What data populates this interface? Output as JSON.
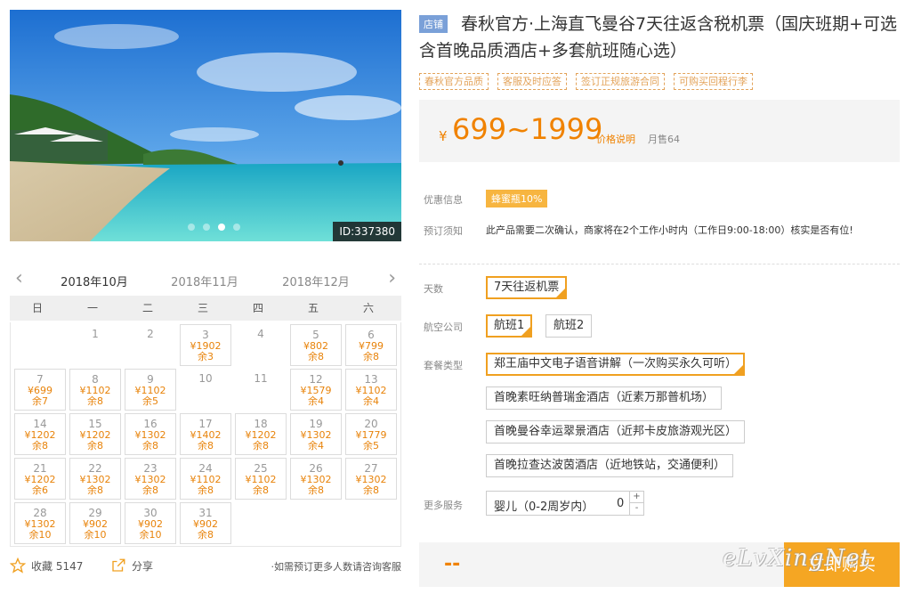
{
  "hero": {
    "id_label": "ID:337380",
    "slides": 4,
    "active_slide": 3
  },
  "calendar": {
    "months": [
      "2018年10月",
      "2018年11月",
      "2018年12月"
    ],
    "active_month": 0,
    "weekdays": [
      "日",
      "一",
      "二",
      "三",
      "四",
      "五",
      "六"
    ],
    "days": [
      {
        "d": "1",
        "price": "",
        "remain": ""
      },
      {
        "d": "2",
        "price": "",
        "remain": ""
      },
      {
        "d": "3",
        "price": "¥1902",
        "remain": "余3"
      },
      {
        "d": "4",
        "price": "",
        "remain": ""
      },
      {
        "d": "5",
        "price": "¥802",
        "remain": "余8"
      },
      {
        "d": "6",
        "price": "¥799",
        "remain": "余8"
      },
      {
        "d": "7",
        "price": "¥699",
        "remain": "余7"
      },
      {
        "d": "8",
        "price": "¥1102",
        "remain": "余8"
      },
      {
        "d": "9",
        "price": "¥1102",
        "remain": "余5"
      },
      {
        "d": "10",
        "price": "",
        "remain": ""
      },
      {
        "d": "11",
        "price": "",
        "remain": ""
      },
      {
        "d": "12",
        "price": "¥1579",
        "remain": "余4"
      },
      {
        "d": "13",
        "price": "¥1102",
        "remain": "余4"
      },
      {
        "d": "14",
        "price": "¥1202",
        "remain": "余8"
      },
      {
        "d": "15",
        "price": "¥1202",
        "remain": "余8"
      },
      {
        "d": "16",
        "price": "¥1302",
        "remain": "余8"
      },
      {
        "d": "17",
        "price": "¥1402",
        "remain": "余8"
      },
      {
        "d": "18",
        "price": "¥1202",
        "remain": "余8"
      },
      {
        "d": "19",
        "price": "¥1302",
        "remain": "余4"
      },
      {
        "d": "20",
        "price": "¥1779",
        "remain": "余5"
      },
      {
        "d": "21",
        "price": "¥1202",
        "remain": "余6"
      },
      {
        "d": "22",
        "price": "¥1302",
        "remain": "余8"
      },
      {
        "d": "23",
        "price": "¥1302",
        "remain": "余8"
      },
      {
        "d": "24",
        "price": "¥1102",
        "remain": "余8"
      },
      {
        "d": "25",
        "price": "¥1102",
        "remain": "余8"
      },
      {
        "d": "26",
        "price": "¥1302",
        "remain": "余8"
      },
      {
        "d": "27",
        "price": "¥1302",
        "remain": "余8"
      },
      {
        "d": "28",
        "price": "¥1302",
        "remain": "余10"
      },
      {
        "d": "29",
        "price": "¥902",
        "remain": "余10"
      },
      {
        "d": "30",
        "price": "¥902",
        "remain": "余10"
      },
      {
        "d": "31",
        "price": "¥902",
        "remain": "余8"
      }
    ]
  },
  "actions": {
    "favorite_label": "收藏 5147",
    "share_label": "分享",
    "consult_note": "·如需预订更多人数请咨询客服"
  },
  "product": {
    "shop_tag": "店铺",
    "title": "春秋官方·上海直飞曼谷7天往返含税机票（国庆班期+可选含首晚品质酒店+多套航班随心选）",
    "features": [
      "春秋官方品质",
      "客服及时应答",
      "签订正规旅游合同",
      "可购买回程行李"
    ]
  },
  "price": {
    "currency": "¥",
    "range": "699~1999",
    "note": "价格说明",
    "sold": "月售64"
  },
  "info": {
    "promo_label": "优惠信息",
    "promo_badge": "蜂蜜瓶10%",
    "notice_label": "预订须知",
    "notice_text": "此产品需要二次确认，商家将在2个工作小时内（工作日9:00-18:00）核实是否有位!"
  },
  "options": {
    "days_label": "天数",
    "days": [
      "7天往返机票"
    ],
    "airline_label": "航空公司",
    "airlines": [
      "航班1",
      "航班2"
    ],
    "package_label": "套餐类型",
    "packages": [
      "郑王庙中文电子语音讲解（一次购买永久可听）",
      "首晚素旺纳普瑞金酒店（近素万那普机场）",
      "首晚曼谷幸运翠景酒店（近邦卡皮旅游观光区）",
      "首晚拉查达波茵酒店（近地铁站，交通便利）"
    ],
    "more_label": "更多服务",
    "infant_label": "婴儿（0-2周岁内）",
    "infant_qty": "0",
    "plus": "+",
    "minus": "-"
  },
  "buy": {
    "price_placeholder": "--",
    "button_label": "立即购买"
  },
  "watermark": "eLvXingNet"
}
